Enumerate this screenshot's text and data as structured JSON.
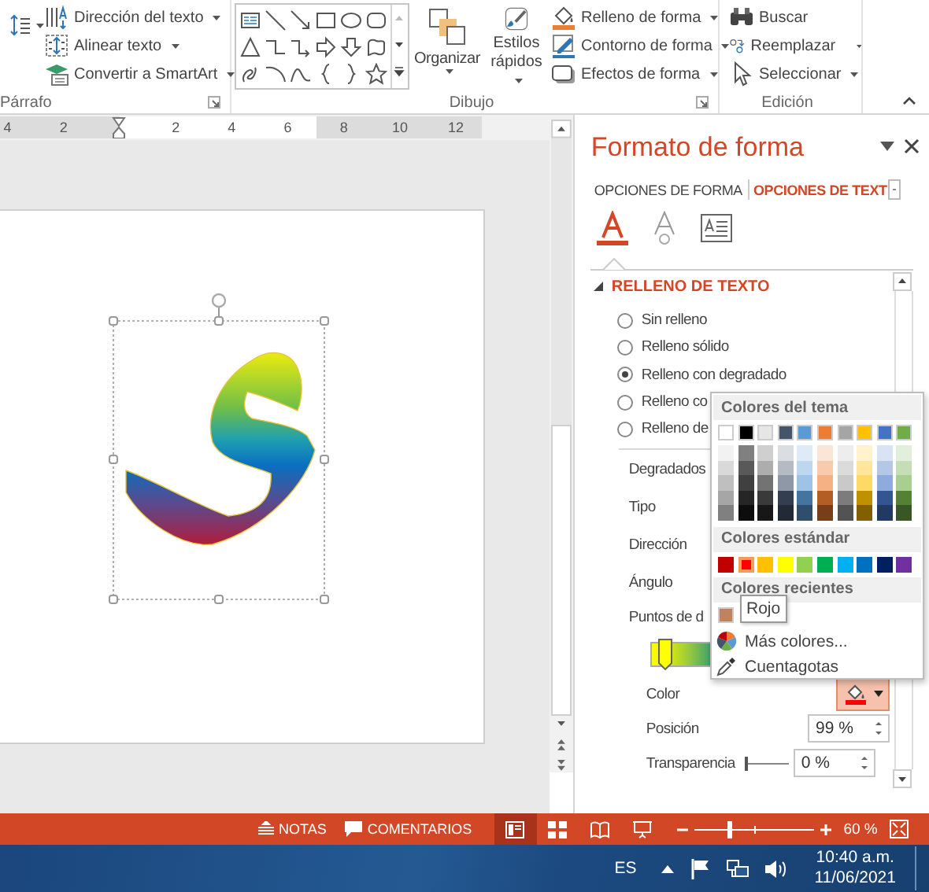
{
  "ribbon": {
    "paragraph_group": {
      "label": "Párrafo",
      "buttons": [
        {
          "label": "Dirección del texto",
          "kind": "text-direction",
          "dropdown": true
        },
        {
          "label": "Alinear texto",
          "kind": "align-text",
          "dropdown": true
        },
        {
          "label": "Convertir a SmartArt",
          "kind": "smartart",
          "dropdown": true
        }
      ]
    },
    "drawing_group": {
      "label": "Dibujo",
      "arrange": "Organizar",
      "quick_styles": "Estilos rápidos",
      "format_buttons": [
        {
          "label": "Relleno de forma",
          "kind": "fill"
        },
        {
          "label": "Contorno de forma",
          "kind": "outline"
        },
        {
          "label": "Efectos de forma",
          "kind": "effects"
        }
      ]
    },
    "editing_group": {
      "label": "Edición",
      "buttons": [
        {
          "label": "Buscar",
          "kind": "find",
          "dropdown": false
        },
        {
          "label": "Reemplazar",
          "kind": "replace",
          "dropdown": true
        },
        {
          "label": "Seleccionar",
          "kind": "select",
          "dropdown": true
        }
      ]
    }
  },
  "ruler": {
    "marks": [
      {
        "kind": "number",
        "label": "4"
      },
      {
        "kind": "number",
        "label": "2"
      },
      {
        "kind": "indent"
      },
      {
        "kind": "number",
        "label": "2"
      },
      {
        "kind": "number",
        "label": "4"
      },
      {
        "kind": "number",
        "label": "6"
      },
      {
        "kind": "number",
        "label": "8"
      },
      {
        "kind": "number",
        "label": "10"
      },
      {
        "kind": "number",
        "label": "12"
      }
    ]
  },
  "pane": {
    "title": "Formato de forma",
    "tabs": [
      {
        "label": "OPCIONES DE FORMA",
        "selected": false
      },
      {
        "label": "OPCIONES DE TEXT",
        "selected": true
      }
    ],
    "icon_tabs": [
      {
        "kind": "text-fill",
        "selected": true
      },
      {
        "kind": "text-effects",
        "selected": false
      },
      {
        "kind": "textbox",
        "selected": false
      }
    ],
    "section": {
      "title": "RELLENO DE TEXTO",
      "expanded": true
    },
    "fill_options": [
      {
        "label": "Sin relleno",
        "selected": false
      },
      {
        "label": "Relleno sólido",
        "selected": false
      },
      {
        "label": "Relleno con degradado",
        "selected": true
      },
      {
        "label": "Relleno co",
        "selected": false
      },
      {
        "label": "Relleno de",
        "selected": false
      }
    ],
    "properties": [
      {
        "kind": "plain",
        "label": "Degradados"
      },
      {
        "kind": "plain",
        "label": "Tipo"
      },
      {
        "kind": "plain",
        "label": "Dirección"
      },
      {
        "kind": "plain",
        "label": "Ángulo"
      },
      {
        "kind": "heading",
        "label": "Puntos de d"
      },
      {
        "kind": "stops"
      },
      {
        "kind": "color",
        "label": "Color",
        "active": true
      },
      {
        "kind": "spin",
        "label": "Posición",
        "value": "99 %"
      },
      {
        "kind": "slider",
        "label": "Transparencia",
        "level": 0,
        "value": "0 %"
      }
    ]
  },
  "color_menu": {
    "theme_title": "Colores del tema",
    "theme_colors": [
      {
        "color": "#ffffff"
      },
      {
        "color": "#000000"
      },
      {
        "color": "#e7e6e6"
      },
      {
        "color": "#44546a"
      },
      {
        "color": "#5b9bd5"
      },
      {
        "color": "#ed7d31"
      },
      {
        "color": "#a5a5a5"
      },
      {
        "color": "#ffc000"
      },
      {
        "color": "#4472c4"
      },
      {
        "color": "#70ad47"
      }
    ],
    "standard_title": "Colores estándar",
    "standard_colors": [
      {
        "color": "#c00000",
        "selected": false
      },
      {
        "color": "#ff0000",
        "selected": true
      },
      {
        "color": "#ffc000",
        "selected": false
      },
      {
        "color": "#ffff00",
        "selected": false
      },
      {
        "color": "#92d050",
        "selected": false
      },
      {
        "color": "#00b050",
        "selected": false
      },
      {
        "color": "#00b0f0",
        "selected": false
      },
      {
        "color": "#0070c0",
        "selected": false
      },
      {
        "color": "#002060",
        "selected": false
      },
      {
        "color": "#7030a0",
        "selected": false
      }
    ],
    "recent_title": "Colores recientes",
    "recent_colors": [
      {
        "color": "#c0825f"
      }
    ],
    "tooltip": "Rojo",
    "items": [
      {
        "kind": "more-colors",
        "label": "Más colores..."
      },
      {
        "kind": "eyedropper",
        "label": "Cuentagotas"
      }
    ]
  },
  "status_bar": {
    "notes": "NOTAS",
    "comments": "COMENTARIOS",
    "views": [
      {
        "kind": "normal",
        "selected": true
      },
      {
        "kind": "sorter",
        "selected": false
      },
      {
        "kind": "reading",
        "selected": false
      },
      {
        "kind": "slideshow",
        "selected": false
      }
    ],
    "zoom": {
      "level": 0.29,
      "value": "60 %"
    }
  },
  "taskbar": {
    "language": "ES",
    "time": "10:40 a.m.",
    "date": "11/06/2021"
  }
}
